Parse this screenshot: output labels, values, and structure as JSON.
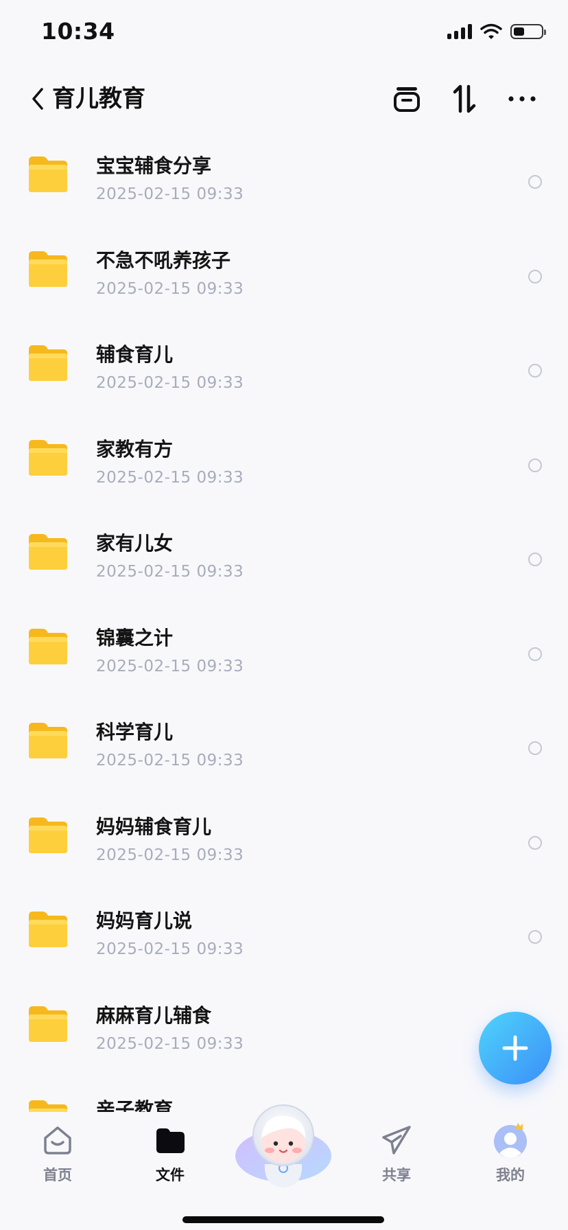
{
  "status": {
    "time": "10:34",
    "battery_level": 0.4
  },
  "header": {
    "title": "育儿教育",
    "back_icon": "chevron-left-icon",
    "actions": [
      "archive-icon",
      "sort-icon",
      "more-icon"
    ]
  },
  "files": [
    {
      "name": "宝宝辅食分享",
      "date": "2025-02-15 09:33"
    },
    {
      "name": "不急不吼养孩子",
      "date": "2025-02-15 09:33"
    },
    {
      "name": "辅食育儿",
      "date": "2025-02-15 09:33"
    },
    {
      "name": "家教有方",
      "date": "2025-02-15 09:33"
    },
    {
      "name": "家有儿女",
      "date": "2025-02-15 09:33"
    },
    {
      "name": "锦囊之计",
      "date": "2025-02-15 09:33"
    },
    {
      "name": "科学育儿",
      "date": "2025-02-15 09:33"
    },
    {
      "name": "妈妈辅食育儿",
      "date": "2025-02-15 09:33"
    },
    {
      "name": "妈妈育儿说",
      "date": "2025-02-15 09:33"
    },
    {
      "name": "麻麻育儿辅食",
      "date": "2025-02-15 09:33"
    },
    {
      "name": "亲子教育",
      "date": ""
    }
  ],
  "fab": {
    "icon": "plus-icon",
    "color": "#3b8ff8"
  },
  "tabs": [
    {
      "label": "首页",
      "icon": "home-icon",
      "active": false
    },
    {
      "label": "文件",
      "icon": "folder-icon",
      "active": true
    },
    {
      "label": "共享",
      "icon": "send-icon",
      "active": false
    },
    {
      "label": "我的",
      "icon": "avatar-icon",
      "active": false
    }
  ],
  "colors": {
    "folder": "#fcc93a",
    "accent": "#3b8ff8",
    "date_text": "#a8acbb"
  }
}
